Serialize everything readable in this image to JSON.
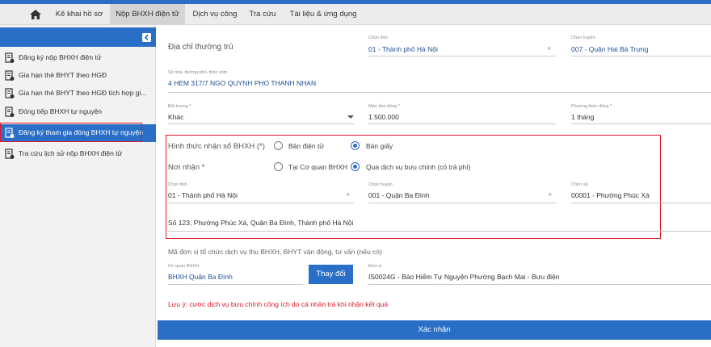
{
  "nav": {
    "tabs": [
      "Kê khai hồ sơ",
      "Nộp BHXH điện tử",
      "Dịch vụ công",
      "Tra cứu",
      "Tài liệu & ứng dụng"
    ]
  },
  "sidebar": {
    "items": [
      "Đăng ký nộp BHXH điện tử",
      "Gia hạn thẻ BHYT theo HGĐ",
      "Gia hạn thẻ BHYT theo HGĐ tích hợp gi...",
      "Đóng tiếp BHXH tự nguyện",
      "Đăng ký tham gia đóng BHXH tự nguyện",
      "Tra cứu lịch sử nộp BHXH điện tử"
    ]
  },
  "form": {
    "address_label": "Địa chỉ thường trú",
    "province_caption": "Chọn tỉnh",
    "province_value": "01 - Thành phố Hà Nội",
    "district_caption": "Chọn huyện",
    "district_value": "007 - Quận Hai Bà Trưng",
    "street_caption": "Số nhà, đường phố, thôn xóm",
    "street_value": "4 HEM 317/7 NGO QUYNH PHO THANH NHAN",
    "subject_caption": "Đối tượng *",
    "subject_value": "Khác",
    "amount_caption": "Mức tiền đóng *",
    "amount_value": "1.500.000",
    "method_caption": "Phương thức đóng *",
    "method_value": "1 tháng"
  },
  "delivery": {
    "book_form_label": "Hình thức nhận sổ BHXH (*)",
    "opt_electronic": "Bản điện tử",
    "opt_paper": "Bản giấy",
    "receive_label": "Nơi nhận *",
    "opt_office": "Tại Cơ quan BHXH",
    "opt_post": "Qua dịch vụ bưu chính (có trả phí)",
    "province_caption": "Chọn tỉnh",
    "province_value": "01 - Thành phố Hà Nội",
    "district_caption": "Chọn huyện",
    "district_value": "001 - Quận Ba Đình",
    "ward_caption": "Chọn xã",
    "ward_value": "00001 - Phường Phúc Xá",
    "address_value": "Số 123, Phường Phúc Xá, Quận Ba Đình, Thành phố Hà Nội"
  },
  "agency": {
    "org_label": "Mã đơn vị tổ chức dịch vụ thu BHXH, BHYT vận động, tư vấn (nếu có)",
    "office_caption": "Cơ quan BHXH",
    "office_value": "BHXH Quận Ba Đình",
    "change_button": "Thay đổi",
    "unit_caption": "Đơn vị",
    "unit_value": "IS0024G - Bảo Hiểm Tự Nguyện Phường Bạch Mai - Bưu điện"
  },
  "note": "Lưu ý: cước dịch vụ bưu chính công ích do cá nhân trả khi nhận kết quả",
  "confirm_button": "Xác nhận",
  "colors": {
    "primary": "#2a6fc7",
    "highlight": "#e0182a"
  }
}
